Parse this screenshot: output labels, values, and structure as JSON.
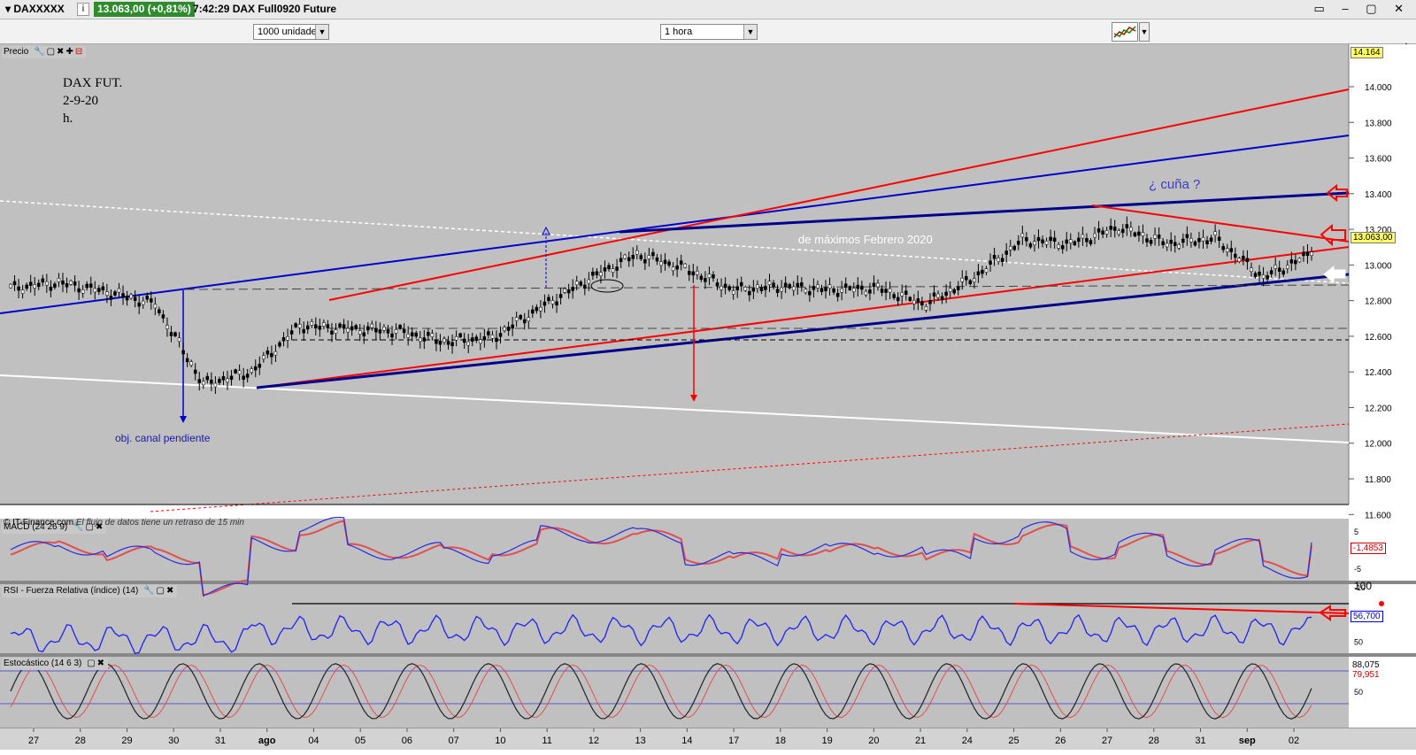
{
  "topbar": {
    "symbol": "DAXXXXX",
    "info_icon": "i",
    "price_badge": "13.063,00 (+0,81%)",
    "time_title": "7:42:29 DAX Full0920 Future",
    "window_controls": "▭ – ▢ ✕"
  },
  "toolbar": {
    "units_value": "1000 unidades",
    "interval_value": "1 hora",
    "chart_type_icon": "candlestick-chart-icon"
  },
  "price_panel": {
    "header": "Precio",
    "title_lines": [
      "DAX FUT.",
      "2-9-20",
      "h."
    ],
    "annotation_wedge": "¿ cuña ?",
    "annotation_febrero": "de máximos Febrero 2020",
    "annotation_objective": "obj. canal pendiente",
    "current_price_label": "13.063,00",
    "top_price_label": "14.164",
    "y_ticks": [
      "14.000",
      "13.800",
      "13.600",
      "13.400",
      "13.200",
      "13.000",
      "12.800",
      "12.600",
      "12.400",
      "12.200",
      "12.000",
      "11.800",
      "11.600"
    ]
  },
  "data_note": {
    "source": "© IT-Finance.com",
    "delay": "El flujo de datos tiene un retraso de 15 min"
  },
  "macd_panel": {
    "header": "MACD (24 26 9)",
    "y_ticks": [
      "5",
      "0",
      "-5",
      "-10"
    ],
    "value_label": "-1,4853"
  },
  "rsi_panel": {
    "header": "RSI - Fuerza Relativa (índice) (14)",
    "y_ticks": [
      "100",
      "50"
    ],
    "value_label": "56,700"
  },
  "stoch_panel": {
    "header": "Estocástico (14 6 3)",
    "y_ticks": [
      "50"
    ],
    "value_label_1": "88,075",
    "value_label_2": "79,951"
  },
  "date_axis": [
    "27",
    "28",
    "29",
    "30",
    "31",
    "ago",
    "04",
    "05",
    "06",
    "07",
    "10",
    "11",
    "12",
    "13",
    "14",
    "17",
    "18",
    "19",
    "20",
    "21",
    "24",
    "25",
    "26",
    "27",
    "28",
    "31",
    "sep",
    "02"
  ],
  "colors": {
    "chart_bg": "#c0c0c0",
    "red_line": "#ff0000",
    "blue_line": "#0000cc",
    "navy_line": "#00008b",
    "rsi_line": "#1f1fff",
    "price_badge_green": "#2e8b2e",
    "label_yellow": "#ffff66"
  },
  "chart_data": {
    "type": "line",
    "title": "DAX FUT.",
    "subtitle": "2-9-20 h.",
    "x_unit": "date",
    "x_categories": [
      "27",
      "28",
      "29",
      "30",
      "31",
      "ago",
      "04",
      "05",
      "06",
      "07",
      "10",
      "11",
      "12",
      "13",
      "14",
      "17",
      "18",
      "19",
      "20",
      "21",
      "24",
      "25",
      "26",
      "27",
      "28",
      "31",
      "sep",
      "02"
    ],
    "ylim": [
      11550,
      14200
    ],
    "series": [
      {
        "values": [
          12870,
          12900,
          12850,
          12780,
          12330,
          12400,
          12660,
          12640,
          12630,
          12570,
          12590,
          12760,
          12920,
          13060,
          12980,
          12860,
          12880,
          12860,
          12870,
          12780,
          12930,
          13140,
          13120,
          13210,
          13120,
          13150,
          12930,
          13063
        ]
      }
    ],
    "last_price": 13063,
    "macd_last": -1.4853,
    "rsi_last": 56.7,
    "stoch_last": [
      88.075,
      79.951
    ],
    "grid": false
  }
}
